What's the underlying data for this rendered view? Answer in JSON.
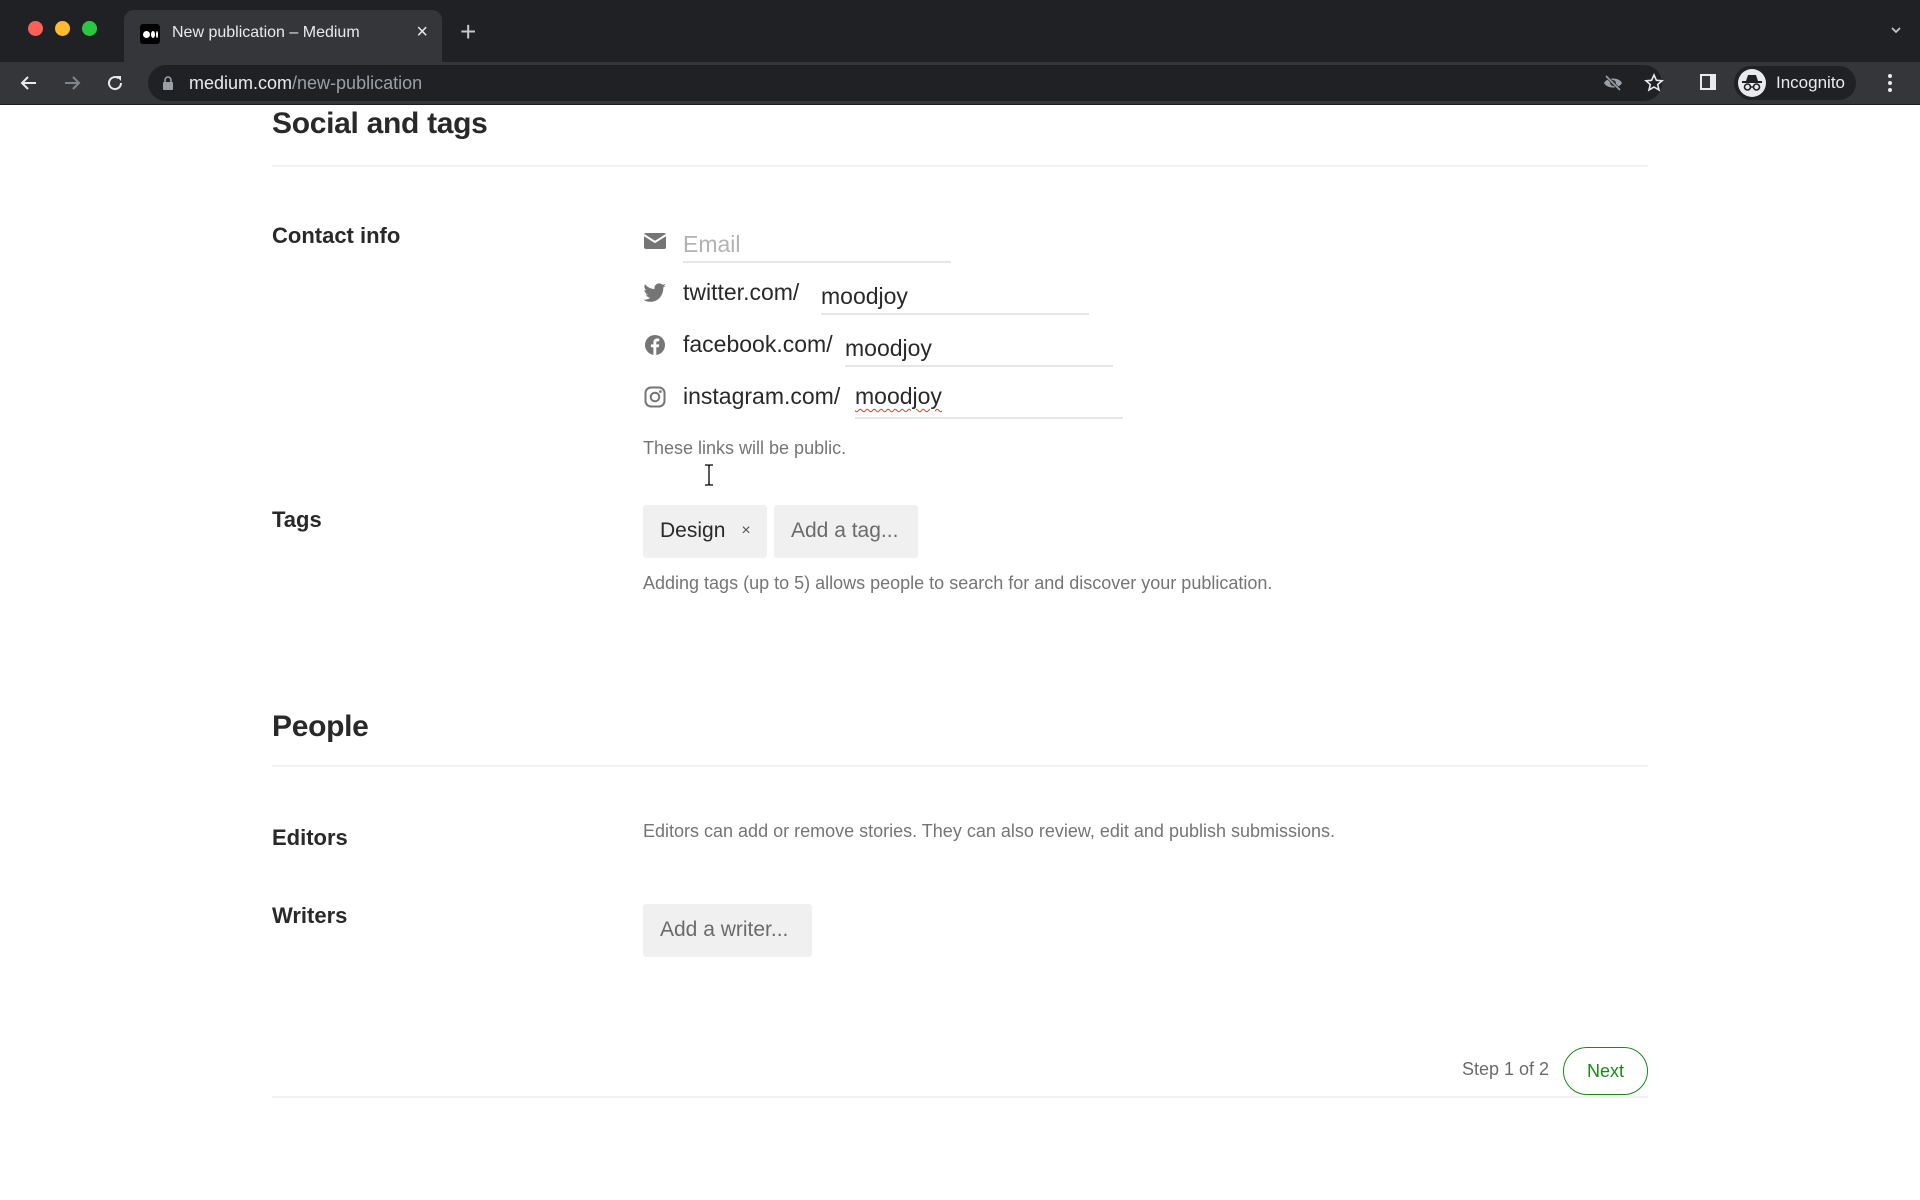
{
  "browser": {
    "tab": {
      "title": "New publication – Medium",
      "favicon": "medium-logo-icon"
    },
    "url": {
      "domain": "medium.com",
      "path": "/new-publication"
    },
    "profile_label": "Incognito",
    "icons": [
      "back-arrow-icon",
      "forward-arrow-icon",
      "reload-icon",
      "lock-icon",
      "eye-off-icon",
      "star-icon",
      "side-panel-icon",
      "incognito-icon",
      "kebab-menu-icon",
      "chevron-down-icon"
    ]
  },
  "social_section": {
    "title": "Social and tags",
    "contact": {
      "label": "Contact info",
      "email": {
        "placeholder": "Email",
        "value": "",
        "icon": "mail-icon"
      },
      "twitter": {
        "prefix": "twitter.com/",
        "value": "moodjoy",
        "icon": "twitter-icon"
      },
      "facebook": {
        "prefix": "facebook.com/",
        "value": "moodjoy",
        "icon": "facebook-icon"
      },
      "instagram": {
        "prefix": "instagram.com/",
        "value": "moodjoy",
        "icon": "instagram-icon"
      },
      "hint": "These links will be public."
    },
    "tags": {
      "label": "Tags",
      "items": [
        {
          "label": "Design",
          "remove": "×"
        }
      ],
      "input_placeholder": "Add a tag...",
      "hint": "Adding tags (up to 5) allows people to search for and discover your publication."
    }
  },
  "people_section": {
    "title": "People",
    "editors": {
      "label": "Editors",
      "description": "Editors can add or remove stories. They can also review, edit and publish submissions."
    },
    "writers": {
      "label": "Writers",
      "input_placeholder": "Add a writer..."
    }
  },
  "footer": {
    "step": "Step 1 of 2",
    "next_label": "Next",
    "accent_color": "#1a8917"
  }
}
